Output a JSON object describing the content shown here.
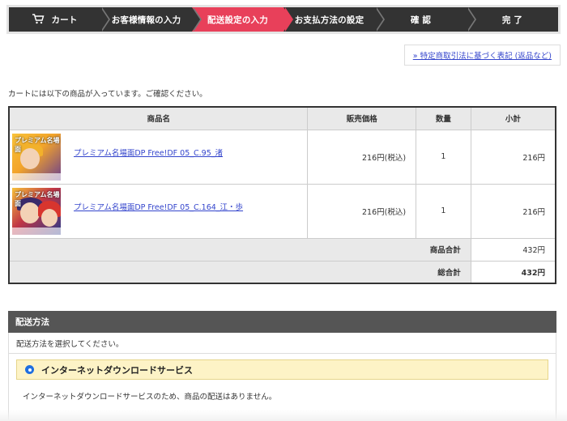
{
  "steps": [
    {
      "label": "カート",
      "icon": "cart-icon",
      "active": false
    },
    {
      "label": "お客様情報の入力",
      "active": false
    },
    {
      "label": "配送設定の入力",
      "active": true
    },
    {
      "label": "お支払方法の設定",
      "active": false
    },
    {
      "label": "確 認",
      "active": false
    },
    {
      "label": "完 了",
      "active": false
    }
  ],
  "colors": {
    "step_active": "#e8405a",
    "step_bg": "#333333",
    "link": "#3344cc",
    "option_bg": "#fdf3c6",
    "radio": "#1f6fe0"
  },
  "law_link": "» 特定商取引法に基づく表記 (返品など)",
  "intro": "カートには以下の商品が入っています。ご確認ください。",
  "table": {
    "headers": {
      "name": "商品名",
      "price": "販売価格",
      "qty": "数量",
      "subtotal": "小計"
    },
    "items": [
      {
        "name": "プレミアム名場面DP Free!DF 05_C.95_渚",
        "price": "216円(税込)",
        "qty": "1",
        "subtotal": "216円",
        "thumb_title": "プレミアム名場面"
      },
      {
        "name": "プレミアム名場面DP Free!DF 05_C.164_江・歩",
        "price": "216円(税込)",
        "qty": "1",
        "subtotal": "216円",
        "thumb_title": "プレミアム名場面"
      }
    ],
    "product_total_label": "商品合計",
    "product_total": "432円",
    "grand_total_label": "総合計",
    "grand_total": "432円"
  },
  "delivery": {
    "heading": "配送方法",
    "instruction": "配送方法を選択してください。",
    "option_label": "インターネットダウンロードサービス",
    "option_note": "インターネットダウンロードサービスのため、商品の配送はありません。"
  }
}
